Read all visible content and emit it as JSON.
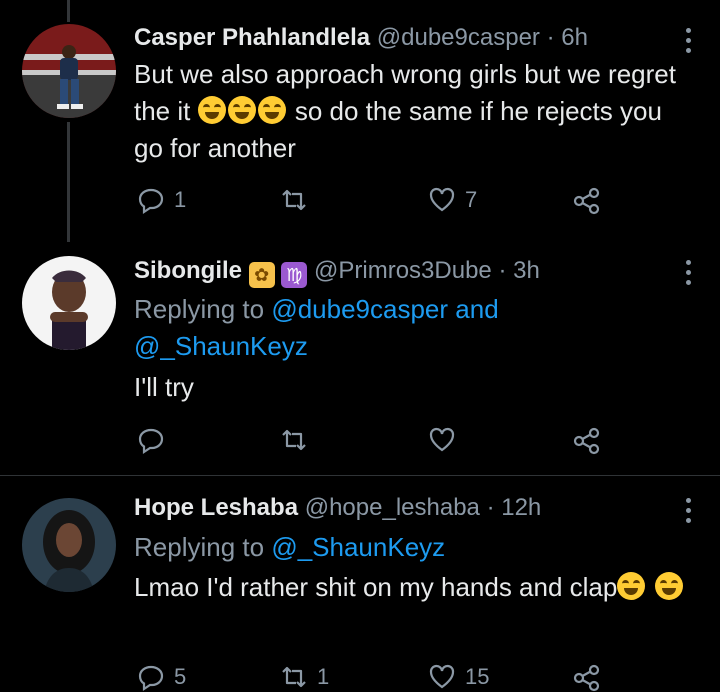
{
  "tweets": [
    {
      "name": "Casper Phahlandlela",
      "handle": "@dube9casper",
      "time": "6h",
      "text_1": "But we also approach wrong girls but we regret the it",
      "text_2": "so do the same if he rejects you go for another",
      "emoji_count": 3,
      "reply_count": "1",
      "retweet_count": "",
      "like_count": "7"
    },
    {
      "name": "Sibongile",
      "badge_1": "fairy-emoji",
      "badge_2": "♍",
      "handle": "@Primros3Dube",
      "time": "3h",
      "replying_label": "Replying to",
      "mention_1": "@dube9casper",
      "mention_and": "and",
      "mention_2": "@_ShaunKeyz",
      "text": "I'll try",
      "reply_count": "",
      "retweet_count": "",
      "like_count": ""
    },
    {
      "name": "Hope Leshaba",
      "handle": "@hope_leshaba",
      "time": "12h",
      "replying_label": "Replying to",
      "mention_1": "@_ShaunKeyz",
      "text": "Lmao I'd rather shit on my hands and clap",
      "reply_count": "5",
      "retweet_count": "1",
      "like_count": "15"
    }
  ],
  "separator": "·",
  "icons": [
    "reply-icon",
    "retweet-icon",
    "like-icon",
    "share-icon",
    "more-icon"
  ],
  "colors": {
    "background": "#000000",
    "text": "#e7e9ea",
    "muted": "#8b98a5",
    "link": "#1d9bf0",
    "divider": "#2f3336"
  }
}
